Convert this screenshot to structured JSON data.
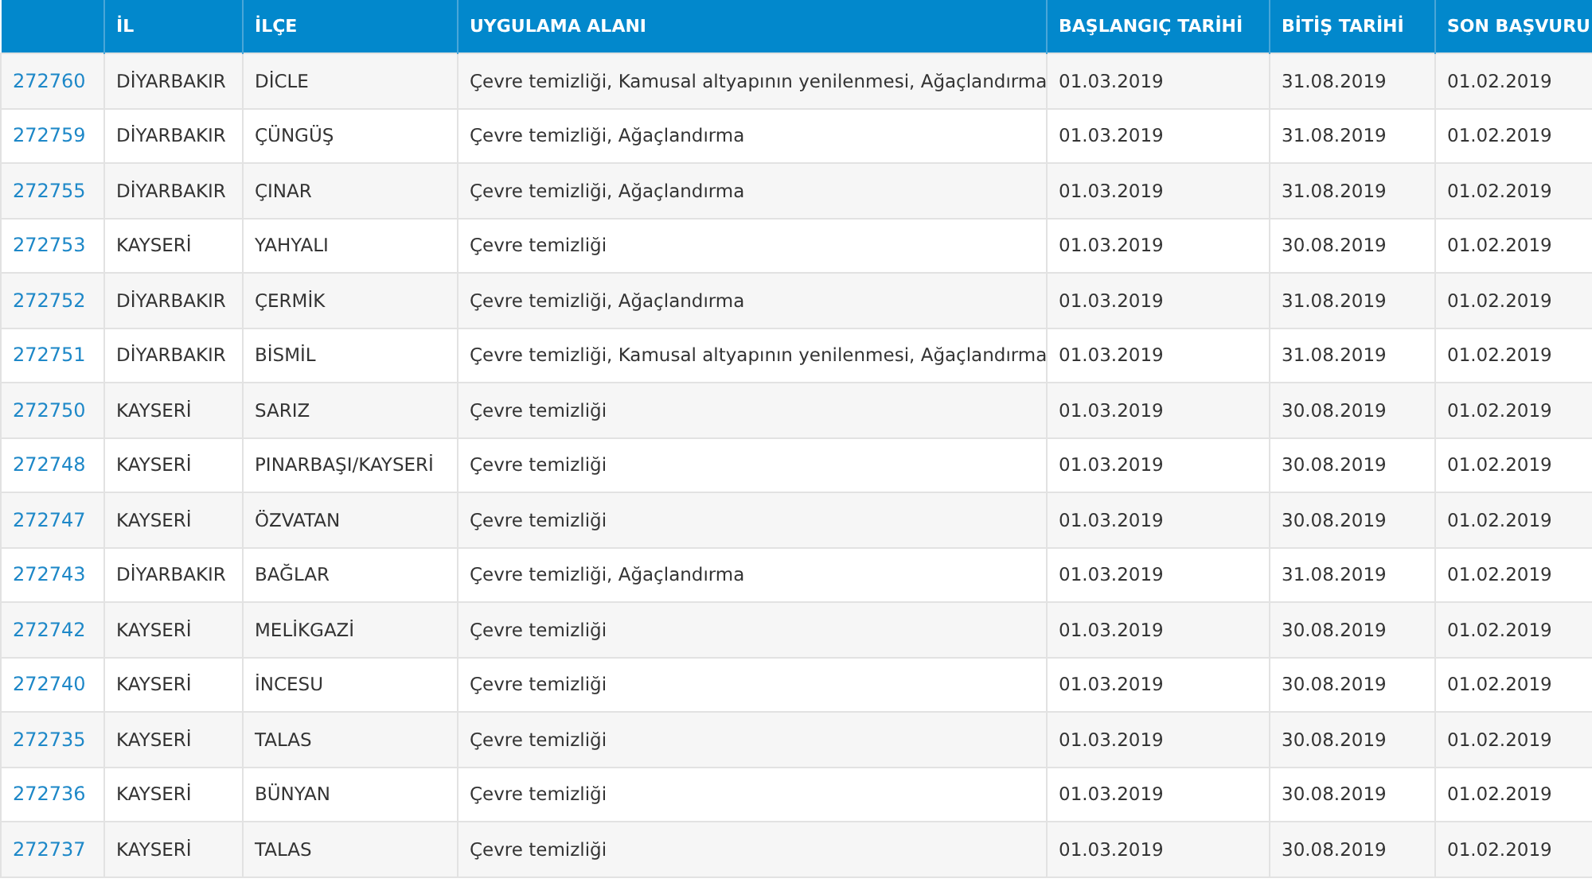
{
  "table": {
    "columns": [
      "",
      "İL",
      "İLÇE",
      "UYGULAMA ALANI",
      "BAŞLANGIÇ TARİHİ",
      "BİTİŞ TARİHİ",
      "SON BAŞVURU"
    ],
    "rows": [
      [
        "272760",
        "DİYARBAKIR",
        "DİCLE",
        "Çevre temizliği, Kamusal altyapının yenilenmesi, Ağaçlandırma",
        "01.03.2019",
        "31.08.2019",
        "01.02.2019"
      ],
      [
        "272759",
        "DİYARBAKIR",
        "ÇÜNGÜŞ",
        "Çevre temizliği, Ağaçlandırma",
        "01.03.2019",
        "31.08.2019",
        "01.02.2019"
      ],
      [
        "272755",
        "DİYARBAKIR",
        "ÇINAR",
        "Çevre temizliği, Ağaçlandırma",
        "01.03.2019",
        "31.08.2019",
        "01.02.2019"
      ],
      [
        "272753",
        "KAYSERİ",
        "YAHYALI",
        "Çevre temizliği",
        "01.03.2019",
        "30.08.2019",
        "01.02.2019"
      ],
      [
        "272752",
        "DİYARBAKIR",
        "ÇERMİK",
        "Çevre temizliği, Ağaçlandırma",
        "01.03.2019",
        "31.08.2019",
        "01.02.2019"
      ],
      [
        "272751",
        "DİYARBAKIR",
        "BİSMİL",
        "Çevre temizliği, Kamusal altyapının yenilenmesi, Ağaçlandırma",
        "01.03.2019",
        "31.08.2019",
        "01.02.2019"
      ],
      [
        "272750",
        "KAYSERİ",
        "SARIZ",
        "Çevre temizliği",
        "01.03.2019",
        "30.08.2019",
        "01.02.2019"
      ],
      [
        "272748",
        "KAYSERİ",
        "PINARBAŞI/KAYSERİ",
        "Çevre temizliği",
        "01.03.2019",
        "30.08.2019",
        "01.02.2019"
      ],
      [
        "272747",
        "KAYSERİ",
        "ÖZVATAN",
        "Çevre temizliği",
        "01.03.2019",
        "30.08.2019",
        "01.02.2019"
      ],
      [
        "272743",
        "DİYARBAKIR",
        "BAĞLAR",
        "Çevre temizliği, Ağaçlandırma",
        "01.03.2019",
        "31.08.2019",
        "01.02.2019"
      ],
      [
        "272742",
        "KAYSERİ",
        "MELİKGAZİ",
        "Çevre temizliği",
        "01.03.2019",
        "30.08.2019",
        "01.02.2019"
      ],
      [
        "272740",
        "KAYSERİ",
        "İNCESU",
        "Çevre temizliği",
        "01.03.2019",
        "30.08.2019",
        "01.02.2019"
      ],
      [
        "272735",
        "KAYSERİ",
        "TALAS",
        "Çevre temizliği",
        "01.03.2019",
        "30.08.2019",
        "01.02.2019"
      ],
      [
        "272736",
        "KAYSERİ",
        "BÜNYAN",
        "Çevre temizliği",
        "01.03.2019",
        "30.08.2019",
        "01.02.2019"
      ],
      [
        "272737",
        "KAYSERİ",
        "TALAS",
        "Çevre temizliği",
        "01.03.2019",
        "30.08.2019",
        "01.02.2019"
      ]
    ]
  }
}
